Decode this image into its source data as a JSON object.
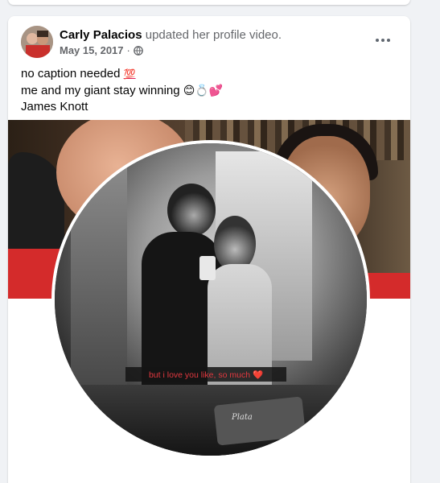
{
  "post": {
    "author": "Carly Palacios",
    "action": "updated her profile video.",
    "date": "May 15, 2017",
    "separator": "·",
    "privacy_icon": "globe-icon",
    "more_icon": "more-horizontal-icon",
    "caption_lines": [
      {
        "text": "no caption needed ",
        "emoji": "💯"
      },
      {
        "text": "me and my giant stay winning ",
        "emoji": "😊💍💕"
      },
      {
        "text": "James Knott",
        "emoji": ""
      }
    ],
    "media": {
      "video_overlay_text": "but i love you  like, so much ❤️",
      "bag_text": "Plata"
    }
  },
  "colors": {
    "background": "#f0f2f5",
    "card": "#ffffff",
    "primary_text": "#050505",
    "secondary_text": "#65676b",
    "overlay_text": "#e2383f"
  }
}
